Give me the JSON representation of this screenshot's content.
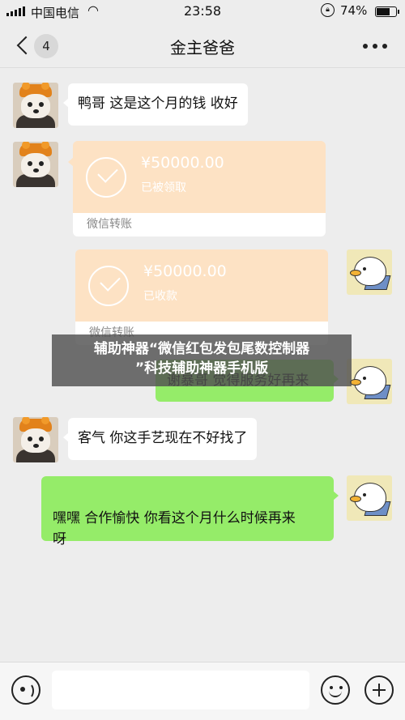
{
  "status_bar": {
    "carrier": "中国电信",
    "time": "23:58",
    "battery_percent": "74%",
    "battery_level": 0.74,
    "signal_icon": "signal-bars-icon",
    "wifi_icon": "wifi-icon",
    "lock_icon": "rotation-lock-icon"
  },
  "nav": {
    "back_icon": "chevron-left-icon",
    "unread_count": "4",
    "title": "金主爸爸",
    "more_icon": "more-dots-icon"
  },
  "messages": [
    {
      "side": "in",
      "type": "text",
      "text": "鸭哥 这是这个月的钱 收好"
    },
    {
      "side": "in",
      "type": "transfer",
      "amount": "¥50000.00",
      "status": "已被领取",
      "label": "微信转账"
    },
    {
      "side": "out",
      "type": "transfer",
      "amount": "¥50000.00",
      "status": "已收款",
      "label": "微信转账"
    },
    {
      "side": "out",
      "type": "text",
      "text": "谢暴哥 觉得服务好再来"
    },
    {
      "side": "in",
      "type": "text",
      "text": "客气 你这手艺现在不好找了"
    },
    {
      "side": "out",
      "type": "text",
      "text": "嘿嘿 合作愉快 你看这个月什么时候再来\n呀"
    }
  ],
  "overlay": {
    "line1": "辅助神器“微信红包发包尾数控制器",
    "line2": "”科技辅助神器手机版"
  },
  "input_bar": {
    "voice_icon": "voice-icon",
    "text_value": "",
    "emoji_icon": "emoji-icon",
    "plus_icon": "plus-icon"
  },
  "colors": {
    "background": "#ededed",
    "outgoing_bubble": "#95ec69",
    "incoming_bubble": "#ffffff",
    "transfer_top": "#fde2c4"
  }
}
